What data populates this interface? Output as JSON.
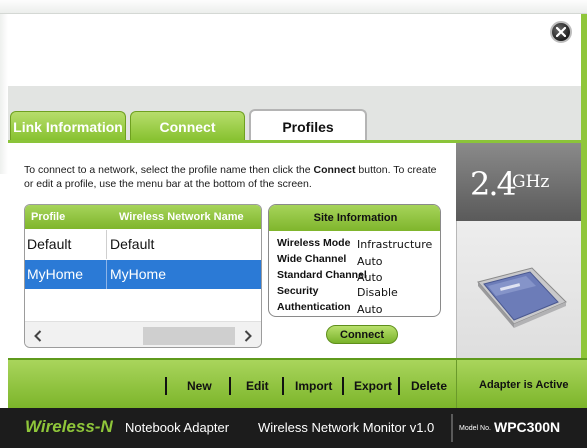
{
  "window": {
    "close_icon": "close-icon"
  },
  "tabs": [
    {
      "label": "Link Information",
      "active": false
    },
    {
      "label": "Connect",
      "active": false
    },
    {
      "label": "Profiles",
      "active": true
    }
  ],
  "instructions": {
    "before": "To connect to a network, select the profile name then click the ",
    "bold": "Connect",
    "after": " button. To create or edit a profile, use the menu bar at the bottom of the screen."
  },
  "profiles": {
    "columns": [
      "Profile",
      "Wireless Network Name"
    ],
    "rows": [
      {
        "profile": "Default",
        "network": "Default",
        "selected": false
      },
      {
        "profile": "MyHome",
        "network": "MyHome",
        "selected": true
      }
    ]
  },
  "site_info": {
    "title": "Site Information",
    "fields": [
      {
        "label": "Wireless Mode",
        "value": "Infrastructure"
      },
      {
        "label": "Wide Channel",
        "value": "Auto"
      },
      {
        "label": "Standard Channel",
        "value": "Auto"
      },
      {
        "label": "Security",
        "value": "Disable"
      },
      {
        "label": "Authentication",
        "value": "Auto"
      }
    ]
  },
  "connect_button": "Connect",
  "frequency": {
    "value": "2.4",
    "unit": "GHz"
  },
  "toolbar": {
    "items": [
      "New",
      "Edit",
      "Import",
      "Export",
      "Delete"
    ]
  },
  "status": "Adapter is Active",
  "footer": {
    "brand": "Wireless-N",
    "product": "Notebook Adapter",
    "monitor": "Wireless Network Monitor  v1.0",
    "model_label": "Model No.",
    "model": "WPC300N"
  },
  "colors": {
    "accent_green": "#8fc63a",
    "selection_blue": "#2b7ad6",
    "footer_dark": "#1c1c1c"
  }
}
